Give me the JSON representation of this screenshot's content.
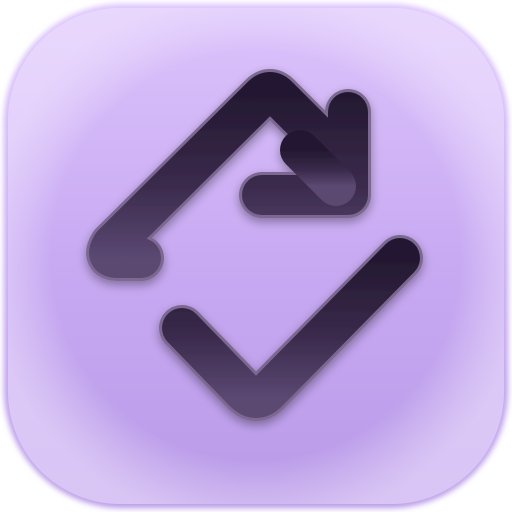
{
  "icon": {
    "name": "sync-check-icon",
    "colors": {
      "tile_top": "#dcc3fb",
      "tile_mid": "#c8aaf3",
      "tile_bottom": "#b99ae8",
      "glyph_dark": "#231830",
      "glyph_mid": "#3a2a4c",
      "glyph_light": "#5b4872",
      "glyph_outline": "#7b6890"
    }
  }
}
